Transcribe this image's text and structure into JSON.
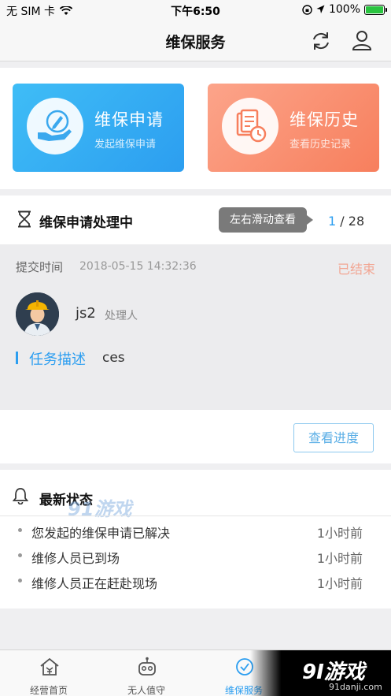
{
  "status_bar": {
    "carrier": "无 SIM 卡",
    "time": "下午6:50",
    "battery": "100%",
    "battery_level": 1.0
  },
  "nav": {
    "title": "维保服务",
    "refresh_icon": "refresh-icon",
    "user_icon": "user-icon"
  },
  "cards": [
    {
      "title": "维保申请",
      "subtitle": "发起维保申请",
      "icon": "hand-pen-icon",
      "color": "#2c9ef0"
    },
    {
      "title": "维保历史",
      "subtitle": "查看历史记录",
      "icon": "document-clock-icon",
      "color": "#f77f5d"
    }
  ],
  "processing": {
    "title": "维保申请处理中",
    "tooltip": "左右滑动查看",
    "page_current": "1",
    "page_total": "/ 28",
    "submit_label": "提交时间",
    "submit_time": "2018-05-15 14:32:36",
    "status": "已结束",
    "handler_name": "js2",
    "handler_role": "处理人",
    "task_label": "任务描述",
    "task_value": "ces",
    "progress_button": "查看进度"
  },
  "latest": {
    "title": "最新状态",
    "watermark": "91游戏",
    "items": [
      {
        "text": "您发起的维保申请已解决",
        "time": "1小时前"
      },
      {
        "text": "维修人员已到场",
        "time": "1小时前"
      },
      {
        "text": "维修人员正在赶赴现场",
        "time": "1小时前"
      }
    ]
  },
  "tabs": [
    {
      "label": "经营首页",
      "icon": "home-icon",
      "active": false
    },
    {
      "label": "无人值守",
      "icon": "robot-icon",
      "active": false
    },
    {
      "label": "维保服务",
      "icon": "service-icon",
      "active": true
    }
  ],
  "brand": {
    "name": "9I游戏",
    "url": "91danji.com"
  },
  "colors": {
    "accent": "#2c9ef0",
    "ended": "#f2a693"
  }
}
